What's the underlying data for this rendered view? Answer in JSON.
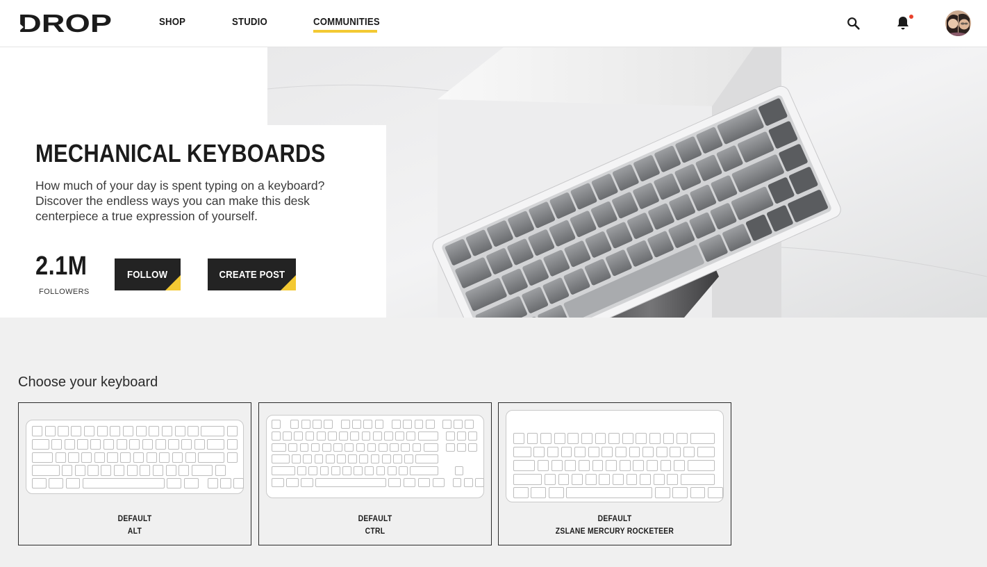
{
  "header": {
    "logo_text": "DROP",
    "nav": [
      {
        "label": "SHOP",
        "active": false
      },
      {
        "label": "STUDIO",
        "active": false
      },
      {
        "label": "COMMUNITIES",
        "active": true
      }
    ],
    "icons": [
      "search-icon",
      "bell-icon",
      "avatar"
    ],
    "accent_color": "#f3c933",
    "notification_dot_color": "#e8412c"
  },
  "hero": {
    "title": "MECHANICAL KEYBOARDS",
    "description": "How much of your day is spent typing on a keyboard? Discover the endless ways you can make this desk centerpiece a true expression of yourself.",
    "followers_count": "2.1M",
    "followers_label": "FOLLOWERS",
    "follow_label": "FOLLOW",
    "create_post_label": "CREATE POST"
  },
  "chooser": {
    "title": "Choose your keyboard",
    "keyboards": [
      {
        "line1": "DEFAULT",
        "line2": "ALT"
      },
      {
        "line1": "DEFAULT",
        "line2": "CTRL"
      },
      {
        "line1": "DEFAULT",
        "line2": "ZSLANE MERCURY ROCKETEER"
      }
    ]
  }
}
